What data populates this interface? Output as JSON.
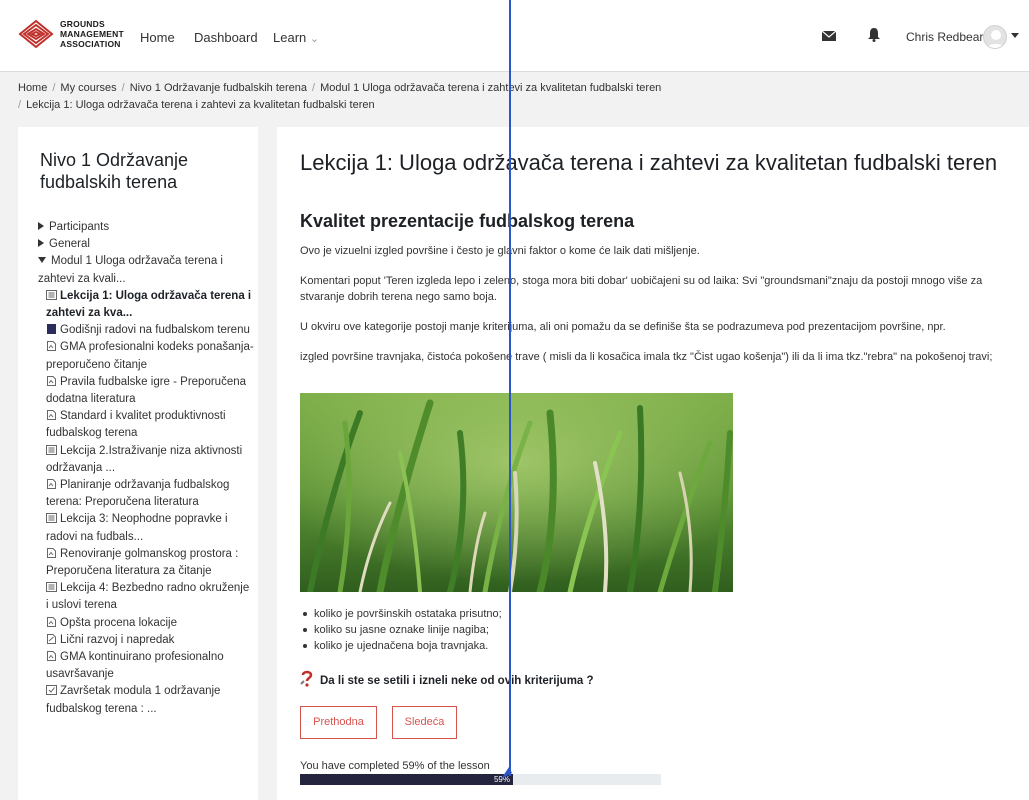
{
  "navbar": {
    "logo_lines": [
      "GROUNDS",
      "MANAGEMENT",
      "ASSOCIATION"
    ],
    "links": [
      "Home",
      "Dashboard",
      "Learn"
    ],
    "learn_caret": "⌄",
    "username": "Chris Redbear",
    "icons": [
      "mail-icon",
      "bell-icon",
      "avatar",
      "caret-icon"
    ]
  },
  "breadcrumb": {
    "items": [
      "Home",
      "My courses",
      "Nivo 1 Održavanje fudbalskih terena",
      "Modul 1 Uloga održavača terena i zahtevi za kvalitetan fudbalski teren",
      "Lekcija 1: Uloga održavača terena i zahtevi za kvalitetan fudbalski teren"
    ],
    "separator": "/"
  },
  "sidebar": {
    "title": "Nivo 1 Održavanje fudbalskih terena",
    "items": [
      {
        "label": "Participants",
        "icon": "triangle-right"
      },
      {
        "label": "General",
        "icon": "triangle-right"
      },
      {
        "label": "Modul 1 Uloga održavača terena i zahtevi za kvali...",
        "icon": "triangle-down"
      },
      {
        "label": "Lekcija 1: Uloga održavača terena i zahtevi za kva...",
        "icon": "lesson-icon",
        "active": true
      },
      {
        "label": "Godišnji radovi na fudbalskom terenu",
        "icon": "book-icon"
      },
      {
        "label": "GMA profesionalni kodeks ponašanja-preporučeno čitanje",
        "icon": "file-icon"
      },
      {
        "label": "Pravila fudbalske igre - Preporučena dodatna literatura",
        "icon": "file-icon"
      },
      {
        "label": "Standard i kvalitet produktivnosti fudbalskog terena",
        "icon": "file-icon"
      },
      {
        "label": "Lekcija 2.Istraživanje niza aktivnosti održavanja ...",
        "icon": "lesson-icon"
      },
      {
        "label": "Planiranje održavanja fudbalskog terena: Preporučena literatura",
        "icon": "file-icon"
      },
      {
        "label": "Lekcija 3: Neophodne popravke i radovi na fudbals...",
        "icon": "lesson-icon"
      },
      {
        "label": "Renoviranje golmanskog prostora : Preporučena literatura za čitanje",
        "icon": "file-icon"
      },
      {
        "label": "Lekcija 4: Bezbedno radno okruženje i uslovi terena",
        "icon": "lesson-icon"
      },
      {
        "label": "Opšta procena lokacije",
        "icon": "file-icon"
      },
      {
        "label": "Lični razvoj i napredak",
        "icon": "file-edit-icon"
      },
      {
        "label": "GMA kontinuirano profesionalno usavršavanje",
        "icon": "file-icon"
      },
      {
        "label": "Završetak modula 1 održavanje fudbalskog terena : ...",
        "icon": "quiz-icon"
      }
    ]
  },
  "main": {
    "title": "Lekcija 1: Uloga održavača terena i zahtevi za kvalitetan fudbalski teren",
    "subtitle": "Kvalitet prezentacije fudbalskog terena",
    "paragraphs": [
      "Ovo je vizuelni izgled površine i često je glavni faktor o kome će laik dati mišljenje.",
      "Komentari poput 'Teren  izgleda lepo i zeleno, stoga mora biti dobar' uobičajeni su od laika: Svi \"groundsmani\"znaju da postoji mnogo više za stvaranje dobrih terena nego samo boja.",
      "U okviru ove kategorije postoji manje kriterijuma, ali oni pomažu da se definiše šta se podrazumeva pod prezentacijom površine, npr.",
      "izgled površine travnjaka, čistoća pokošene  trave ( misli  da li kosačica imala tkz \"Čist ugao košenja\") ili da li ima tkz.\"rebra\"  na pokošenoj travi;"
    ],
    "bullets": [
      "koliko je površinskih ostataka prisutno;",
      "koliko su jasne oznake linije nagiba;",
      "koliko je ujednačena boja travnjaka."
    ],
    "question": "Da li ste se setili i izneli neke od ovih kriterijuma ?",
    "prev_button": "Prethodna",
    "next_button": "Sledeća",
    "progress_text": "You have completed 59% of the lesson",
    "progress_label": "59%",
    "progress_value": 59
  },
  "colors": {
    "accent": "#d9534f",
    "progress": "#24243e",
    "annotation": "#2b56c8"
  }
}
